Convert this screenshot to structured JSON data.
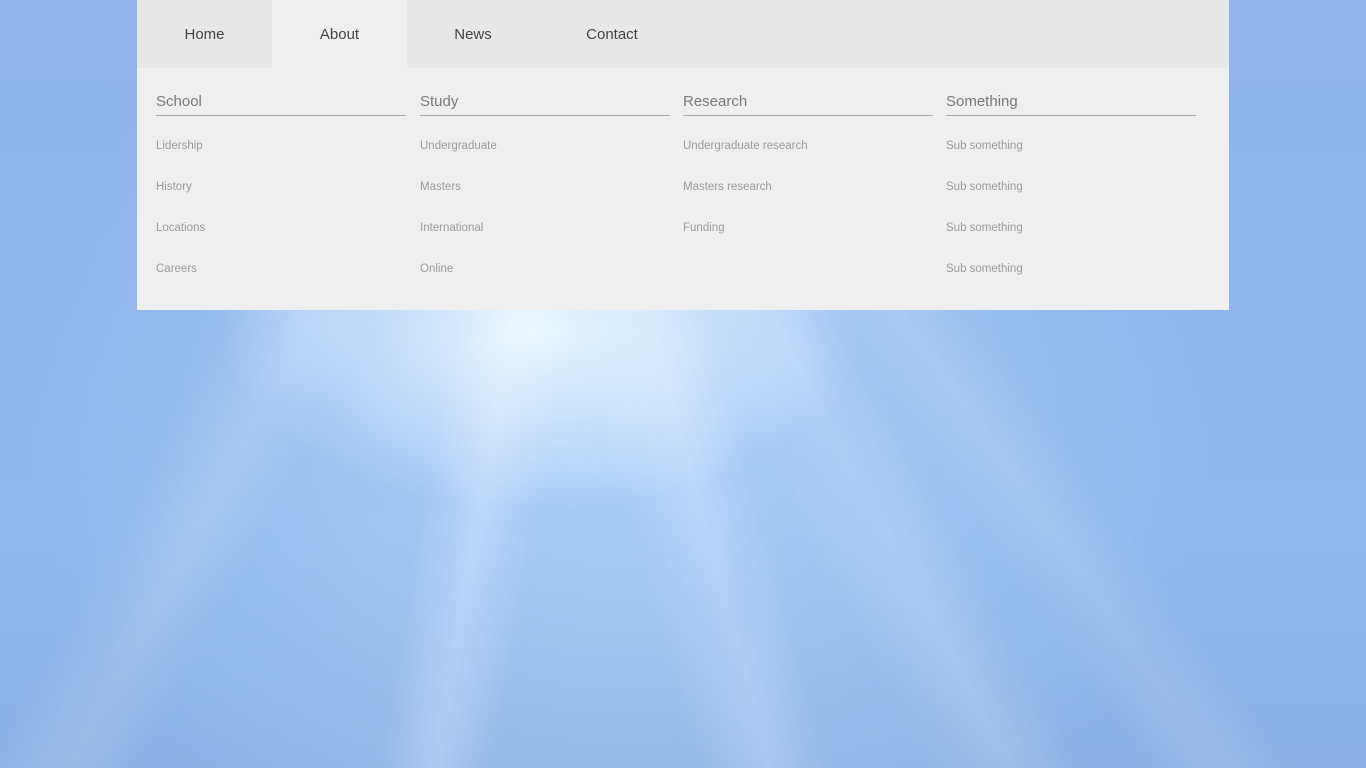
{
  "nav": {
    "tabs": [
      {
        "label": "Home"
      },
      {
        "label": "About"
      },
      {
        "label": "News"
      },
      {
        "label": "Contact"
      }
    ],
    "active": "About"
  },
  "mega_menu": {
    "columns": [
      {
        "heading": "School",
        "items": [
          "Lidership",
          "History",
          "Locations",
          "Careers"
        ]
      },
      {
        "heading": "Study",
        "items": [
          "Undergraduate",
          "Masters",
          "International",
          "Online"
        ]
      },
      {
        "heading": "Research",
        "items": [
          "Undergraduate research",
          "Masters research",
          "Funding"
        ]
      },
      {
        "heading": "Something",
        "items": [
          "Sub something",
          "Sub something",
          "Sub something",
          "Sub something"
        ]
      }
    ]
  },
  "colors": {
    "topbar": "#e8e8e8",
    "dropdown": "#efefef",
    "background": "#8fb3ea"
  }
}
